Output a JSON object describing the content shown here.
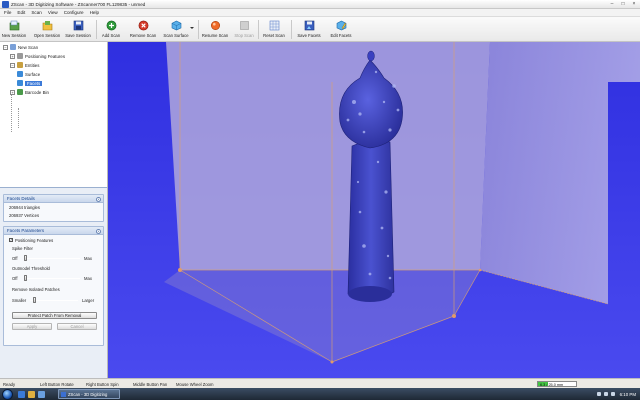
{
  "window": {
    "title": "ZScan - 3D Digitizing Software - ZScanner700 FL129835 - unmed",
    "controls": [
      "–",
      "□",
      "×"
    ]
  },
  "menu": [
    "File",
    "Edit",
    "Scan",
    "View",
    "Configure",
    "Help"
  ],
  "toolbar": {
    "buttons": [
      {
        "label": "New Session",
        "icon": "new-session-icon",
        "color": "#4a8a3c"
      },
      {
        "label": "Open Session",
        "icon": "open-folder-icon",
        "color": "#e0a820"
      },
      {
        "label": "Save Session",
        "icon": "save-disk-icon",
        "color": "#3a5fbf"
      },
      {
        "label": "Add Scan",
        "icon": "add-icon",
        "color": "#2e9a3a"
      },
      {
        "label": "Remove Scan",
        "icon": "remove-icon",
        "color": "#d43a2a"
      },
      {
        "label": "Scan Surface",
        "icon": "cube-icon",
        "color": "#4aa0e0"
      },
      {
        "label": "Resume Scan",
        "icon": "record-icon",
        "color": "#e05a20"
      },
      {
        "label": "Stop Scan",
        "icon": "stop-icon",
        "color": "#bbbbbb"
      },
      {
        "label": "Reset Scan",
        "icon": "reset-grid-icon",
        "color": "#5a7fc8"
      },
      {
        "label": "Save Facets",
        "icon": "save-facets-icon",
        "color": "#3a5fbf"
      },
      {
        "label": "Edit Facets",
        "icon": "edit-facets-icon",
        "color": "#4aa0e0"
      }
    ]
  },
  "tree": {
    "root": "New Scan",
    "items": [
      {
        "label": "Positioning Features",
        "expander": "+"
      },
      {
        "label": "Entities",
        "expander": "−"
      },
      {
        "label": "Surface"
      },
      {
        "label": "Facets",
        "selected": true
      },
      {
        "label": "Barcode Bin",
        "expander": "+"
      }
    ]
  },
  "facets_details": {
    "title": "Facets Details",
    "lines": [
      "206944 triangles",
      "206937 Vertices"
    ]
  },
  "facets_parameters": {
    "title": "Facets Parameters",
    "checkbox_label": "Positioning Features",
    "spike_filter": {
      "label": "Spike Filter",
      "min": "Off",
      "max": "Max"
    },
    "outmodel_threshold": {
      "label": "Outmodel Threshold",
      "min": "Off",
      "max": "Max"
    },
    "isolated_patches": {
      "label": "Remove Isolated Patches",
      "min": "Smaller",
      "max": "Larger"
    },
    "protect_button": "Protect Patch From Removal",
    "apply_button": "Apply",
    "cancel_button": "Cancel"
  },
  "status": {
    "ready": "Ready",
    "left_hint": "Left Button Rotate",
    "right_hint": "Right Button Spin",
    "middle_hint": "Middle Button Pan",
    "wheel_hint": "Mouse Wheel Zoom",
    "progress_text": "6.3 / 25.0 mm",
    "progress_fraction": 0.25
  },
  "taskbar": {
    "app_button": "ZScan - 3D Digitizing",
    "clock": "6:10 PM"
  },
  "colors": {
    "viewport_bg": "#3838e6",
    "mesh": "#3d44c8",
    "box_edge": "#d9a070"
  }
}
